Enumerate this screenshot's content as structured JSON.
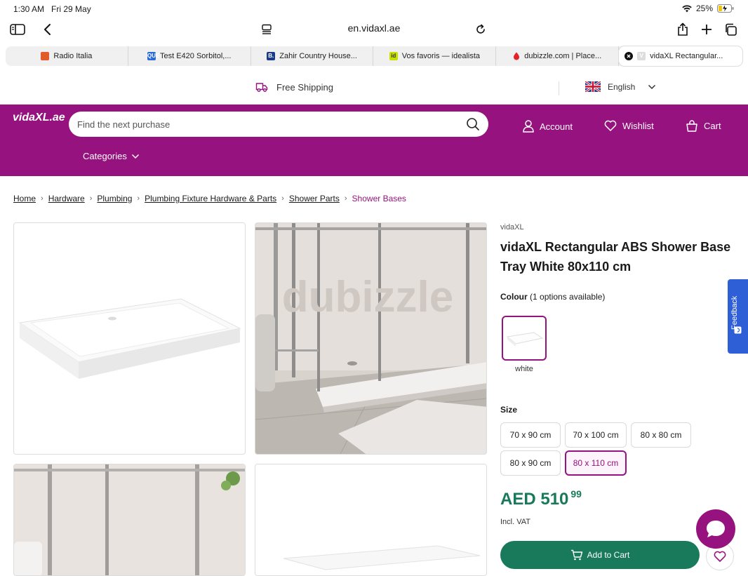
{
  "status_bar": {
    "time": "1:30 AM",
    "date": "Fri 29 May",
    "battery": "25%"
  },
  "browser": {
    "url": "en.vidaxl.ae",
    "tabs": [
      {
        "label": "Radio Italia",
        "favicon_color": "#e05a2a"
      },
      {
        "label": "Test E420 Sorbitol,...",
        "favicon_color": "#2a6ad8",
        "favicon_text": "QUE"
      },
      {
        "label": "Zahir Country House...",
        "favicon_color": "#1b3a8a",
        "favicon_text": "B."
      },
      {
        "label": "Vos favoris — idealista",
        "favicon_color": "#c8e000",
        "favicon_text": "id"
      },
      {
        "label": "dubizzle.com | Place...",
        "favicon_color": "#e0242a"
      },
      {
        "label": "vidaXL Rectangular...",
        "favicon_color": "#cccccc",
        "favicon_text": "V",
        "active": true
      }
    ]
  },
  "shipping_bar": {
    "free_shipping": "Free Shipping",
    "language": "English"
  },
  "header": {
    "logo": "vidaXL.ae",
    "search_placeholder": "Find the next purchase",
    "account": "Account",
    "wishlist": "Wishlist",
    "cart": "Cart",
    "categories": "Categories"
  },
  "breadcrumb": {
    "items": [
      "Home",
      "Hardware",
      "Plumbing",
      "Plumbing Fixture Hardware & Parts",
      "Shower Parts"
    ],
    "current": "Shower Bases"
  },
  "gallery": {
    "watermark": "dubizzle"
  },
  "product": {
    "brand": "vidaXL",
    "title": "vidaXL Rectangular ABS Shower Base Tray White 80x110 cm",
    "colour_label": "Colour",
    "colour_options": "(1 options available)",
    "colour_selected": "white",
    "size_label": "Size",
    "sizes": [
      "70 x 90 cm",
      "70 x 100 cm",
      "80 x 80 cm",
      "80 x 90 cm",
      "80 x 110 cm"
    ],
    "selected_size": "80 x 110 cm",
    "price_currency": "AED",
    "price_main": "510",
    "price_cents": "99",
    "vat": "Incl. VAT",
    "add_to_cart": "Add to Cart"
  },
  "feedback": "Feedback",
  "colors": {
    "brand": "#96127e",
    "price": "#187a5a",
    "feedback": "#2f5fd6"
  }
}
